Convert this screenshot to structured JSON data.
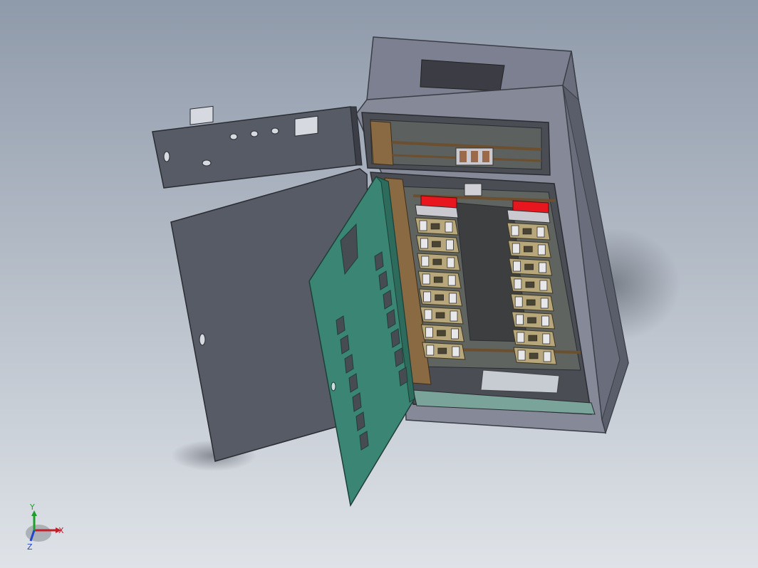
{
  "viewport": {
    "background_top": "#8f9aaa",
    "background_bottom": "#dfe3e8"
  },
  "model": {
    "cabinet_color": "#7f8392",
    "cabinet_dark": "#5b5f6c",
    "panel_color": "#575b66",
    "door_color": "#3b8574",
    "mount_rail_color": "#8a6a42",
    "handle_color": "#e8171f",
    "breaker_color": "#b7a77a",
    "breaker_count_per_row": 8,
    "breaker_rows": 2
  },
  "triad": {
    "x_label": "X",
    "y_label": "Y",
    "z_label": "Z",
    "x_color": "#c0202a",
    "y_color": "#1f9e2c",
    "z_color": "#2446c8"
  }
}
